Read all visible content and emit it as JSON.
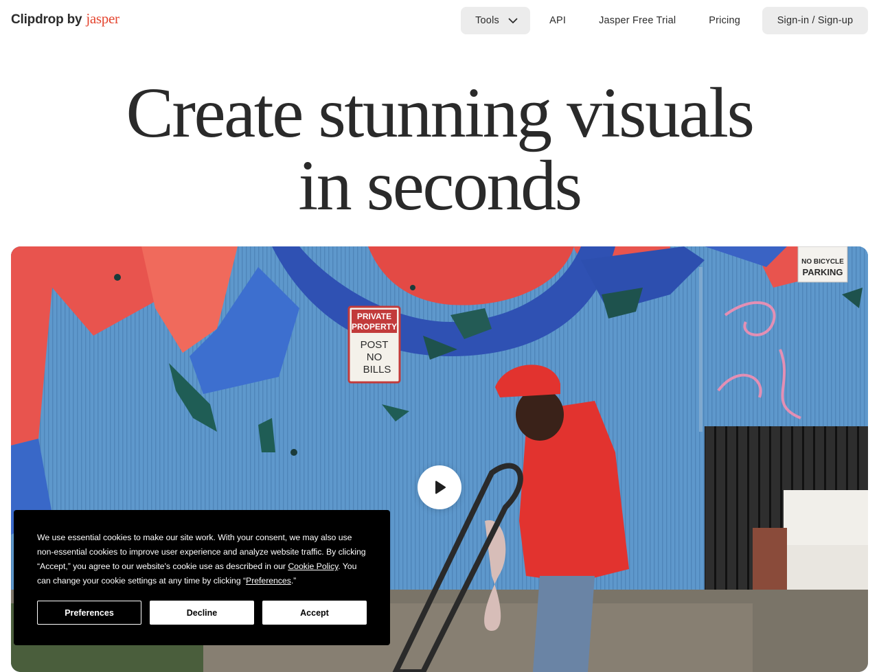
{
  "header": {
    "logo_main": "Clipdrop by",
    "logo_brand": "jasper",
    "nav": {
      "tools": "Tools",
      "api": "API",
      "trial": "Jasper Free Trial",
      "pricing": "Pricing",
      "signin": "Sign-in / Sign-up"
    }
  },
  "hero": {
    "title_line1": "Create stunning visuals",
    "title_line2": "in seconds"
  },
  "media": {
    "sign_private_1": "PRIVATE",
    "sign_private_2": "PROPERTY",
    "sign_private_3": "POST",
    "sign_private_4": "NO",
    "sign_private_5": "BILLS",
    "sign_bicycle_1": "NO BICYCLE",
    "sign_bicycle_2": "PARKING",
    "play_icon": "play-icon"
  },
  "cookie": {
    "text_before_policy": "We use essential cookies to make our site work. With your consent, we may also use non-essential cookies to improve user experience and analyze website traffic. By clicking “Accept,” you agree to our website's cookie use as described in our ",
    "policy_link": "Cookie Policy",
    "text_after_policy": ". You can change your cookie settings at any time by clicking “",
    "preferences_link": "Preferences",
    "text_end": ".”",
    "buttons": {
      "preferences": "Preferences",
      "decline": "Decline",
      "accept": "Accept"
    }
  },
  "colors": {
    "brand": "#e4452f",
    "nav_pill": "#ececec",
    "text": "#2b2b2b",
    "cookie_bg": "#000000"
  }
}
